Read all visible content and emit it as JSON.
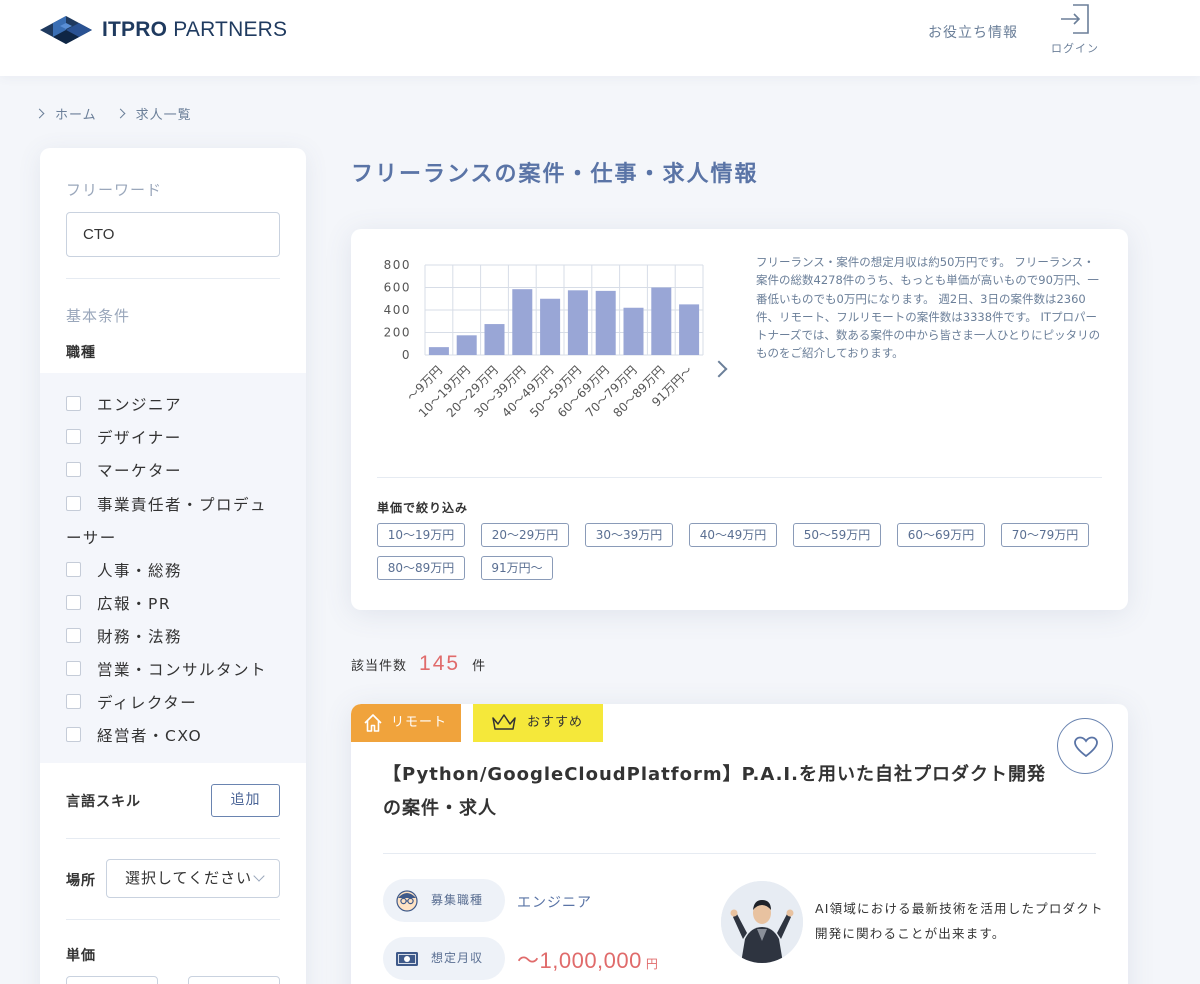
{
  "header": {
    "logo_bold": "ITPRO",
    "logo_text": "PARTNERS",
    "nav_info": "お役立ち情報",
    "login_label": "ログイン"
  },
  "breadcrumb": [
    "ホーム",
    "求人一覧"
  ],
  "sidebar": {
    "freeword_label": "フリーワード",
    "freeword_value": "CTO",
    "basic_label": "基本条件",
    "job_type_label": "職種",
    "job_types": [
      "エンジニア",
      "デザイナー",
      "マーケター",
      "事業責任者・プロデュ",
      "人事・総務",
      "広報・PR",
      "財務・法務",
      "営業・コンサルタント",
      "ディレクター",
      "経営者・CXO"
    ],
    "job_type_wrap": "ーサー",
    "lang_label": "言語スキル",
    "add_label": "追加",
    "location_label": "場所",
    "location_value": "選択してください",
    "price_label": "単価"
  },
  "main": {
    "title": "フリーランスの案件・仕事・求人情報",
    "chart_description": "フリーランス・案件の想定月収は約50万円です。 フリーランス・案件の総数4278件のうち、もっとも単価が高いもので90万円、一番低いものでも0万円になります。 週2日、3日の案件数は2360件、リモート、フルリモートの案件数は3338件です。 ITプロパートナーズでは、数ある案件の中から皆さま一人ひとりにピッタリのものをご紹介しております。",
    "filter_title": "単価で絞り込み",
    "filter_tags": [
      "10〜19万円",
      "20〜29万円",
      "30〜39万円",
      "40〜49万円",
      "50〜59万円",
      "60〜69万円",
      "70〜79万円",
      "80〜89万円",
      "91万円〜"
    ],
    "count_label": "該当件数",
    "count_value": "145",
    "count_unit": "件"
  },
  "chart_data": {
    "type": "bar",
    "categories": [
      "〜9万円",
      "10〜19万円",
      "20〜29万円",
      "30〜39万円",
      "40〜49万円",
      "50〜59万円",
      "60〜69万円",
      "70〜79万円",
      "80〜89万円",
      "91万円〜"
    ],
    "values": [
      70,
      175,
      275,
      585,
      500,
      575,
      570,
      420,
      600,
      450
    ],
    "yticks": [
      "0",
      "200",
      "400",
      "600",
      "800"
    ],
    "ylim": [
      0,
      800
    ],
    "grid": true,
    "bar_color": "#99a6d6"
  },
  "job": {
    "tag_remote": "リモート",
    "tag_recommend": "おすすめ",
    "title": "【Python/GoogleCloudPlatform】P.A.I.を用いた自社プロダクト開発の案件・求人",
    "type_label": "募集職種",
    "type_value": "エンジニア",
    "salary_label": "想定月収",
    "salary_value": "〜1,000,000",
    "salary_unit": "円",
    "catch": "AI領域における最新技術を活用したプロダクト開発に関わることが出来ます。"
  },
  "colors": {
    "accent": "#5a74a6",
    "remote": "#f0a33c",
    "recommend": "#f5e83a",
    "price": "#e06b6b"
  }
}
